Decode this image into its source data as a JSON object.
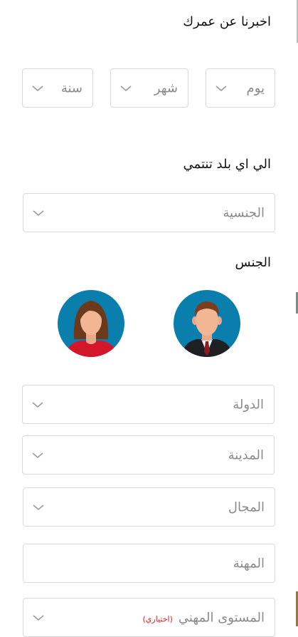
{
  "age_section": {
    "title": "اخبرنا عن عمرك",
    "day_placeholder": "يوم",
    "month_placeholder": "شهر",
    "year_placeholder": "سنة"
  },
  "nationality_section": {
    "title": "الي اي بلد تنتمي",
    "nationality_placeholder": "الجنسية"
  },
  "gender_section": {
    "title": "الجنس",
    "male_icon": "male-avatar-icon",
    "female_icon": "female-avatar-icon"
  },
  "location": {
    "country_placeholder": "الدولة",
    "city_placeholder": "المدينة"
  },
  "career": {
    "field_placeholder": "المجال",
    "profession_placeholder": "المهنة",
    "level_placeholder": "المستوى المهني",
    "optional_tag": "(اختياري)"
  },
  "colors": {
    "avatar_bg": "#0a7fae",
    "optional_red": "#e02020"
  }
}
